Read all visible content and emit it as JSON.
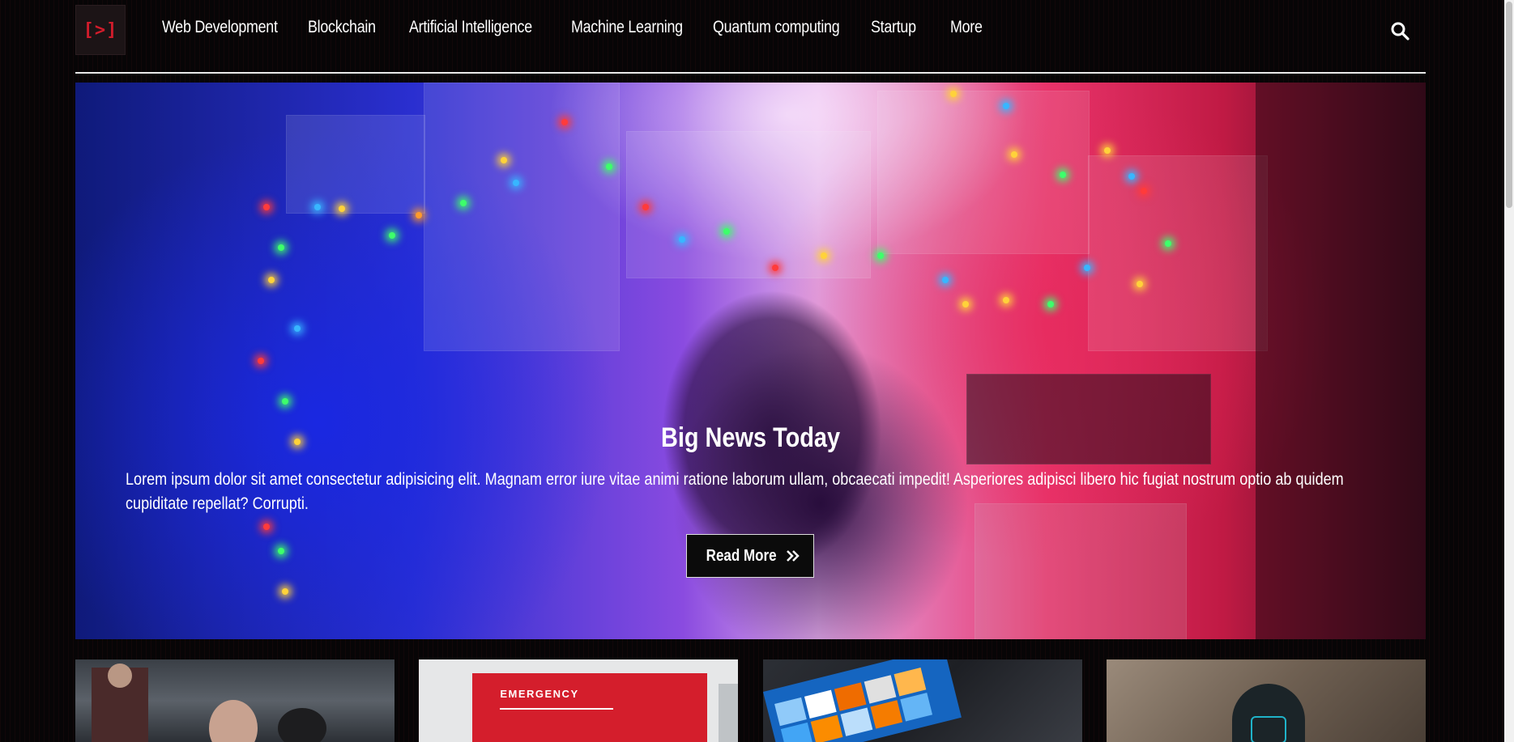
{
  "header": {
    "logo_text": "[>]",
    "nav": [
      {
        "label": "Web Development"
      },
      {
        "label": "Blockchain"
      },
      {
        "label": "Artificial Intelligence"
      },
      {
        "label": "Machine Learning"
      },
      {
        "label": "Quantum computing"
      },
      {
        "label": "Startup"
      },
      {
        "label": "More"
      }
    ],
    "search_icon": "search-icon"
  },
  "hero": {
    "title": "Big News Today",
    "text": "Lorem ipsum dolor sit amet consectetur adipisicing elit. Magnam error iure vitae animi ratione laborum ullam, obcaecati impedit! Asperiores adipisci libero hic fugiat nostrum optio ab quidem cupiditate repellat? Corrupti.",
    "read_more_label": "Read More",
    "read_more_icon": "double-chevron-right-icon"
  },
  "cards": [
    {
      "image": "meeting-photo"
    },
    {
      "image": "emergency-sign-photo",
      "sign_text": "EMERGENCY"
    },
    {
      "image": "tablet-photo"
    },
    {
      "image": "hooded-figure-photo"
    }
  ],
  "colors": {
    "accent": "#d11c2b",
    "background": "#070506",
    "text": "#ffffff"
  }
}
